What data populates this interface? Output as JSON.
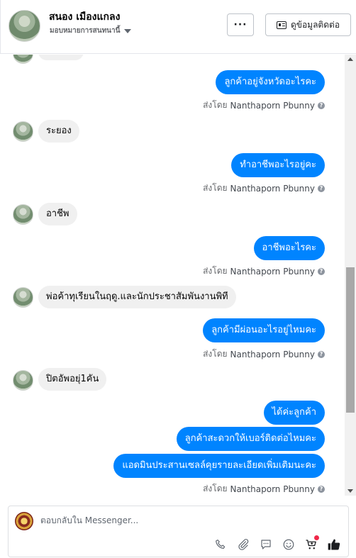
{
  "header": {
    "contact_name": "สนอง เมืองแกลง",
    "status_label": "มอบหมายการสนทนานี้",
    "more_label": "···",
    "info_button_label": "ดูข้อมูลติดต่อ"
  },
  "conversation": {
    "sent_by_prefix": "ส่งโดย",
    "sender_name": "Nanthaporn Pbunny",
    "info_symbol": "?",
    "messages": [
      {
        "direction": "out",
        "text": "ลูกค้าอยู่จังหวัดอะไรคะ"
      },
      {
        "direction": "in",
        "text": "ระยอง"
      },
      {
        "direction": "out",
        "text": "ทำอาชีพอะไรอยู่คะ"
      },
      {
        "direction": "in",
        "text": "อาชีพ"
      },
      {
        "direction": "out",
        "text": "อาชีพอะไรคะ"
      },
      {
        "direction": "in",
        "text": "พ่อค้าทุเรียนในฤดู.และนักประชาสัมพันงานพิที"
      },
      {
        "direction": "out",
        "text": "ลูกค้ามีผ่อนอะไรอยู่ไหมคะ"
      },
      {
        "direction": "in",
        "text": "ปิตอัพอยุ่1คัน"
      },
      {
        "direction": "out",
        "text": "ได้ค่ะลูกค้า"
      },
      {
        "direction": "out",
        "text": "ลูกค้าสะดวกให้เบอร์ติดต่อไหมคะ"
      },
      {
        "direction": "out",
        "text": "แอดมินประสานเซลล์คุยรายละเอียดเพิ่มเติมนะคะ"
      }
    ]
  },
  "composer": {
    "placeholder": "ตอบกลับใน Messenger..."
  },
  "icons": {
    "toolbar": [
      "phone-icon",
      "paperclip-icon",
      "chat-template-icon",
      "emoji-icon",
      "cart-icon",
      "thumbs-up-icon"
    ]
  },
  "colors": {
    "outgoing_bubble": "#0084ff",
    "incoming_bubble": "#f0f0f0",
    "thumbs_up": "#1c1e21",
    "notification_dot": "#f02849"
  }
}
